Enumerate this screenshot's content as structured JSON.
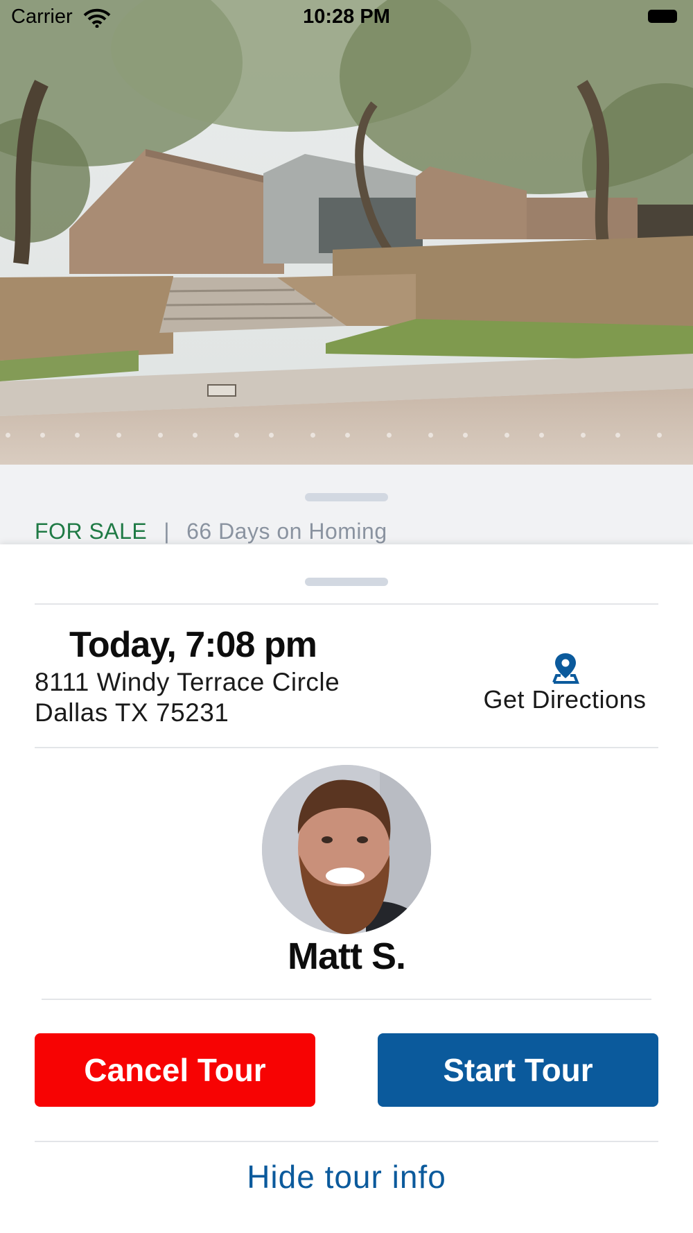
{
  "status_bar": {
    "carrier": "Carrier",
    "time": "10:28 PM",
    "icons": [
      "wifi-icon",
      "battery-icon"
    ]
  },
  "listing": {
    "photo": "house-photo",
    "status": "FOR SALE",
    "separator": "|",
    "days_on_market": "66 Days on Homing",
    "status_color": "#1f7a45"
  },
  "tour": {
    "time": "Today, 7:08 pm",
    "address_line1": "8111 Windy Terrace Circle",
    "address_line2": "Dallas TX 75231",
    "directions_label": "Get Directions",
    "directions_icon": "map-pin-icon"
  },
  "agent": {
    "name": "Matt S.",
    "avatar": "agent-avatar"
  },
  "actions": {
    "cancel_label": "Cancel Tour",
    "start_label": "Start Tour",
    "hide_label": "Hide tour info",
    "cancel_color": "#f70303",
    "start_color": "#0b5a9c"
  }
}
